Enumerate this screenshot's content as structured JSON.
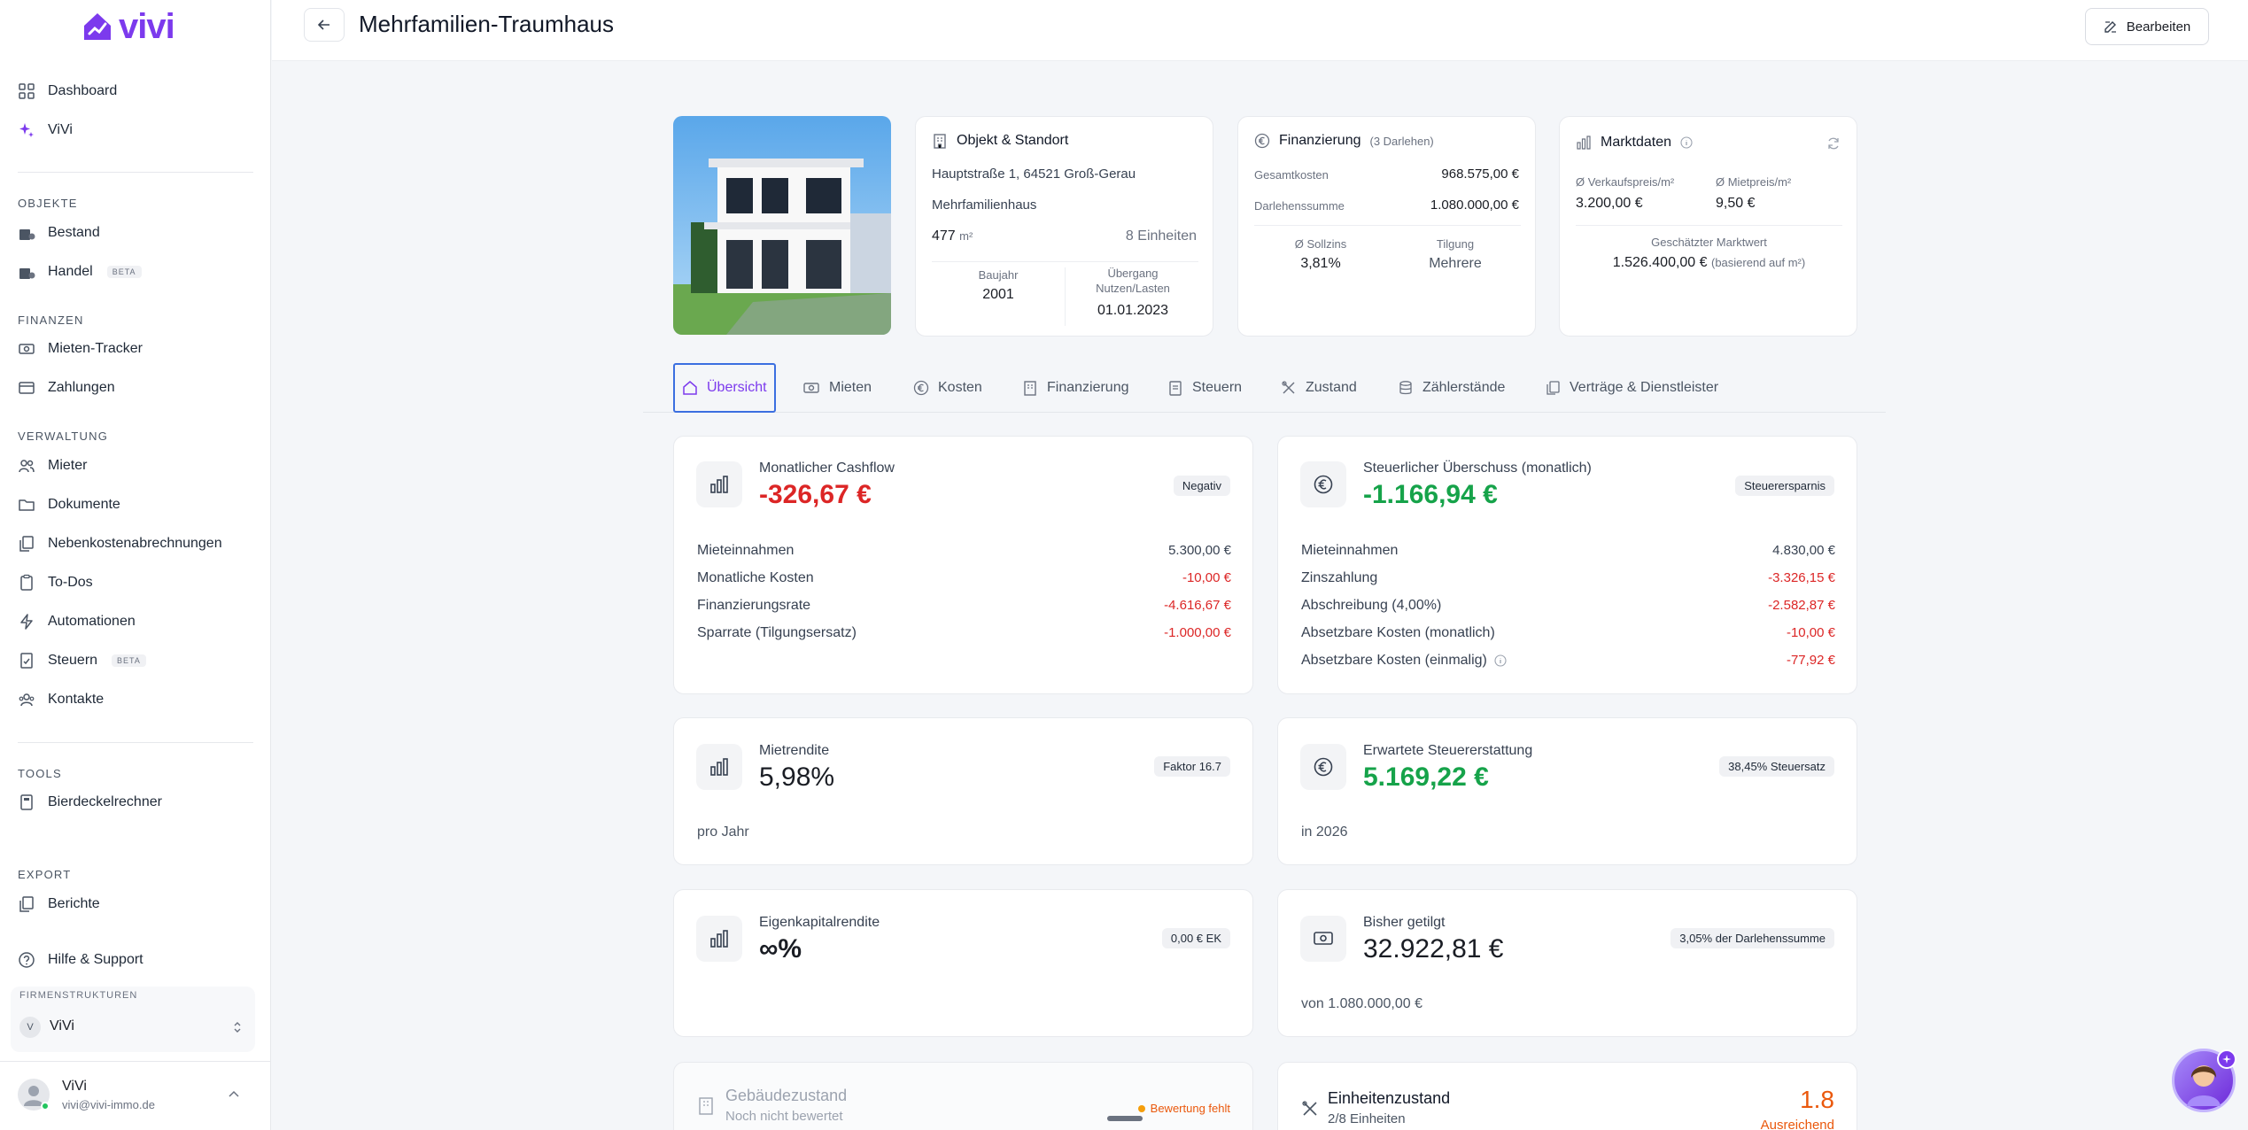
{
  "app": {
    "name": "vivi"
  },
  "sidebar": {
    "top_items": [
      {
        "label": "Dashboard",
        "icon": "grid-icon"
      },
      {
        "label": "ViVi",
        "icon": "sparkles-icon"
      }
    ],
    "sections": [
      {
        "label": "OBJEKTE",
        "items": [
          {
            "label": "Bestand",
            "icon": "building-icon"
          },
          {
            "label": "Handel",
            "icon": "building-icon",
            "badge": "BETA"
          }
        ]
      },
      {
        "label": "FINANZEN",
        "items": [
          {
            "label": "Mieten-Tracker",
            "icon": "banknote-icon"
          },
          {
            "label": "Zahlungen",
            "icon": "credit-card-icon"
          }
        ]
      },
      {
        "label": "VERWALTUNG",
        "items": [
          {
            "label": "Mieter",
            "icon": "users-icon"
          },
          {
            "label": "Dokumente",
            "icon": "folder-icon"
          },
          {
            "label": "Nebenkostenabrechnungen",
            "icon": "files-icon"
          },
          {
            "label": "To-Dos",
            "icon": "clipboard-icon"
          },
          {
            "label": "Automationen",
            "icon": "zap-icon"
          },
          {
            "label": "Steuern",
            "icon": "receipt-icon",
            "badge": "BETA"
          },
          {
            "label": "Kontakte",
            "icon": "contacts-icon"
          }
        ]
      },
      {
        "label": "TOOLS",
        "items": [
          {
            "label": "Bierdeckelrechner",
            "icon": "calculator-icon"
          }
        ]
      },
      {
        "label": "EXPORT",
        "items": [
          {
            "label": "Berichte",
            "icon": "files-icon"
          }
        ]
      }
    ],
    "help": "Hilfe & Support",
    "company_label": "FIRMENSTRUKTUREN",
    "company_initial": "V",
    "company_name": "ViVi",
    "user_name": "ViVi",
    "user_email": "vivi@vivi-immo.de"
  },
  "header": {
    "title": "Mehrfamilien-Traumhaus",
    "edit_label": "Bearbeiten"
  },
  "object": {
    "title": "Objekt & Standort",
    "address": "Hauptstraße 1, 64521 Groß-Gerau",
    "type": "Mehrfamilienhaus",
    "area_value": "477",
    "area_unit": "m²",
    "units_value": "8",
    "units_label": "Einheiten",
    "baujahr_label": "Baujahr",
    "baujahr": "2001",
    "uebergang_label_1": "Übergang",
    "uebergang_label_2": "Nutzen/Lasten",
    "uebergang": "01.01.2023"
  },
  "financing": {
    "title": "Finanzierung",
    "count": "(3 Darlehen)",
    "gesamtkosten_label": "Gesamtkosten",
    "gesamtkosten": "968.575,00 €",
    "darlehen_label": "Darlehenssumme",
    "darlehen": "1.080.000,00 €",
    "sollzins_label": "Ø Sollzins",
    "sollzins": "3,81%",
    "tilgung_label": "Tilgung",
    "tilgung": "Mehrere"
  },
  "market": {
    "title": "Marktdaten",
    "vk_label": "Ø Verkaufspreis/m²",
    "vk": "3.200,00 €",
    "miet_label": "Ø Mietpreis/m²",
    "miet": "9,50 €",
    "wert_label": "Geschätzter Marktwert",
    "wert": "1.526.400,00 €",
    "wert_note": "(basierend auf m²)"
  },
  "tabs": [
    {
      "label": "Übersicht",
      "icon": "home-icon",
      "active": true
    },
    {
      "label": "Mieten",
      "icon": "banknote-icon"
    },
    {
      "label": "Kosten",
      "icon": "euro-icon"
    },
    {
      "label": "Finanzierung",
      "icon": "building-icon"
    },
    {
      "label": "Steuern",
      "icon": "receipt-icon"
    },
    {
      "label": "Zustand",
      "icon": "tools-icon"
    },
    {
      "label": "Zählerstände",
      "icon": "database-icon"
    },
    {
      "label": "Verträge & Dienstleister",
      "icon": "files-icon"
    }
  ],
  "cashflow": {
    "title": "Monatlicher Cashflow",
    "value": "-326,67 €",
    "badge": "Negativ",
    "rows": [
      {
        "label": "Mieteinnahmen",
        "value": "5.300,00 €",
        "neg": false
      },
      {
        "label": "Monatliche Kosten",
        "value": "-10,00 €",
        "neg": true
      },
      {
        "label": "Finanzierungsrate",
        "value": "-4.616,67 €",
        "neg": true
      },
      {
        "label": "Sparrate (Tilgungsersatz)",
        "value": "-1.000,00 €",
        "neg": true
      }
    ]
  },
  "tax": {
    "title": "Steuerlicher Überschuss (monatlich)",
    "value": "-1.166,94 €",
    "badge": "Steuerersparnis",
    "rows": [
      {
        "label": "Mieteinnahmen",
        "value": "4.830,00 €",
        "neg": false
      },
      {
        "label": "Zinszahlung",
        "value": "-3.326,15 €",
        "neg": true
      },
      {
        "label": "Abschreibung (4,00%)",
        "value": "-2.582,87 €",
        "neg": true
      },
      {
        "label": "Absetzbare Kosten (monatlich)",
        "value": "-10,00 €",
        "neg": true
      },
      {
        "label": "Absetzbare Kosten (einmalig)",
        "value": "-77,92 €",
        "neg": true
      }
    ]
  },
  "mietrendite": {
    "title": "Mietrendite",
    "value": "5,98%",
    "badge": "Faktor 16.7",
    "note": "pro Jahr"
  },
  "erstattung": {
    "title": "Erwartete Steuererstattung",
    "value": "5.169,22 €",
    "badge": "38,45% Steuersatz",
    "note": "in 2026"
  },
  "ek": {
    "title": "Eigenkapitalrendite",
    "value": "∞%",
    "badge": "0,00 € EK"
  },
  "getilgt": {
    "title": "Bisher getilgt",
    "value": "32.922,81 €",
    "badge": "3,05% der Darlehenssumme",
    "note": "von 1.080.000,00 €"
  },
  "gebaeude": {
    "title": "Gebäudezustand",
    "subtitle": "Noch nicht bewertet",
    "status": "Bewertung fehlt"
  },
  "einheiten": {
    "title": "Einheitenzustand",
    "subtitle": "2/8 Einheiten",
    "score": "1.8",
    "score_label": "Ausreichend"
  },
  "colors": {
    "brand": "#7c3aed",
    "negative": "#dc2626",
    "positive": "#16a34a",
    "warning": "#ea580c"
  }
}
